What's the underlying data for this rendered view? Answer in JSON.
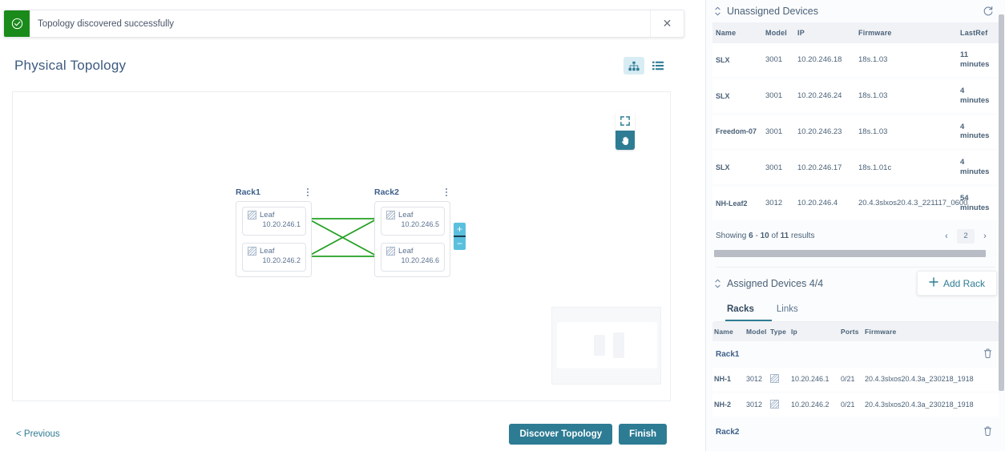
{
  "toast": {
    "message": "Topology discovered successfully",
    "close_label": "✕",
    "icon": "check-circle-icon",
    "color": "#1a8a1a"
  },
  "header": {
    "title": "Physical Topology",
    "view_toggles": [
      {
        "name": "topology-view",
        "icon": "topology-icon",
        "active": true
      },
      {
        "name": "list-view",
        "icon": "list-icon",
        "active": false
      }
    ]
  },
  "canvas": {
    "tools": [
      {
        "name": "fullscreen",
        "icon": "fullscreen-icon",
        "active": false
      },
      {
        "name": "pan",
        "icon": "hand-icon",
        "active": true
      }
    ],
    "zoom_controls": {
      "zoom_in": "+",
      "zoom_out": "−"
    },
    "racks": [
      {
        "name": "Rack1",
        "devices": [
          {
            "label": "Leaf",
            "ip": "10.20.246.1"
          },
          {
            "label": "Leaf",
            "ip": "10.20.246.2"
          }
        ]
      },
      {
        "name": "Rack2",
        "devices": [
          {
            "label": "Leaf",
            "ip": "10.20.246.5"
          },
          {
            "label": "Leaf",
            "ip": "10.20.246.6"
          }
        ]
      }
    ],
    "link_color": "#22a022"
  },
  "footer": {
    "previous_label": "< Previous",
    "discover_label": "Discover Topology",
    "finish_label": "Finish"
  },
  "unassigned": {
    "title": "Unassigned Devices",
    "refresh_icon": "refresh-icon",
    "collapse_icon": "collapse-icon",
    "columns": [
      "Name",
      "Model",
      "IP",
      "Firmware",
      "LastRef"
    ],
    "rows": [
      {
        "name": "SLX",
        "model": "3001",
        "ip": "10.20.246.18",
        "firmware": "18s.1.03",
        "lastref_value": "11",
        "lastref_unit": "minutes"
      },
      {
        "name": "SLX",
        "model": "3001",
        "ip": "10.20.246.24",
        "firmware": "18s.1.03",
        "lastref_value": "4",
        "lastref_unit": "minutes"
      },
      {
        "name": "Freedom-07",
        "model": "3001",
        "ip": "10.20.246.23",
        "firmware": "18s.1.03",
        "lastref_value": "4",
        "lastref_unit": "minutes"
      },
      {
        "name": "SLX",
        "model": "3001",
        "ip": "10.20.246.17",
        "firmware": "18s.1.01c",
        "lastref_value": "4",
        "lastref_unit": "minutes"
      },
      {
        "name": "NH-Leaf2",
        "model": "3012",
        "ip": "10.20.246.4",
        "firmware": "20.4.3slxos20.4.3_221117_0600",
        "lastref_value": "54",
        "lastref_unit": "minutes"
      }
    ],
    "paging": {
      "prefix": "Showing",
      "from": "6",
      "dash": "-",
      "to": "10",
      "of": "of",
      "total": "11",
      "suffix": "results",
      "prev": "‹",
      "current_page": "2",
      "next": "›"
    }
  },
  "assigned": {
    "title": "Assigned Devices 4/4",
    "collapse_icon": "collapse-icon",
    "add_rack_label": "Add Rack",
    "add_rack_icon": "plus-icon",
    "tabs": [
      {
        "label": "Racks",
        "active": true
      },
      {
        "label": "Links",
        "active": false
      }
    ],
    "columns": [
      "Name",
      "Model",
      "Type",
      "Ip",
      "Ports",
      "Firmware"
    ],
    "groups": [
      {
        "rack_name": "Rack1",
        "delete_icon": "trash-icon",
        "rows": [
          {
            "name": "NH-1",
            "model": "3012",
            "type": "switch-icon",
            "ip": "10.20.246.1",
            "ports": "0/21",
            "firmware": "20.4.3slxos20.4.3a_230218_1918"
          },
          {
            "name": "NH-2",
            "model": "3012",
            "type": "switch-icon",
            "ip": "10.20.246.2",
            "ports": "0/21",
            "firmware": "20.4.3slxos20.4.3a_230218_1918"
          }
        ]
      },
      {
        "rack_name": "Rack2",
        "delete_icon": "trash-icon",
        "rows": []
      }
    ]
  },
  "theme": {
    "accent": "#2e7c94",
    "success": "#1a8a1a",
    "text": "#4a6178",
    "link_green": "#22a022"
  }
}
